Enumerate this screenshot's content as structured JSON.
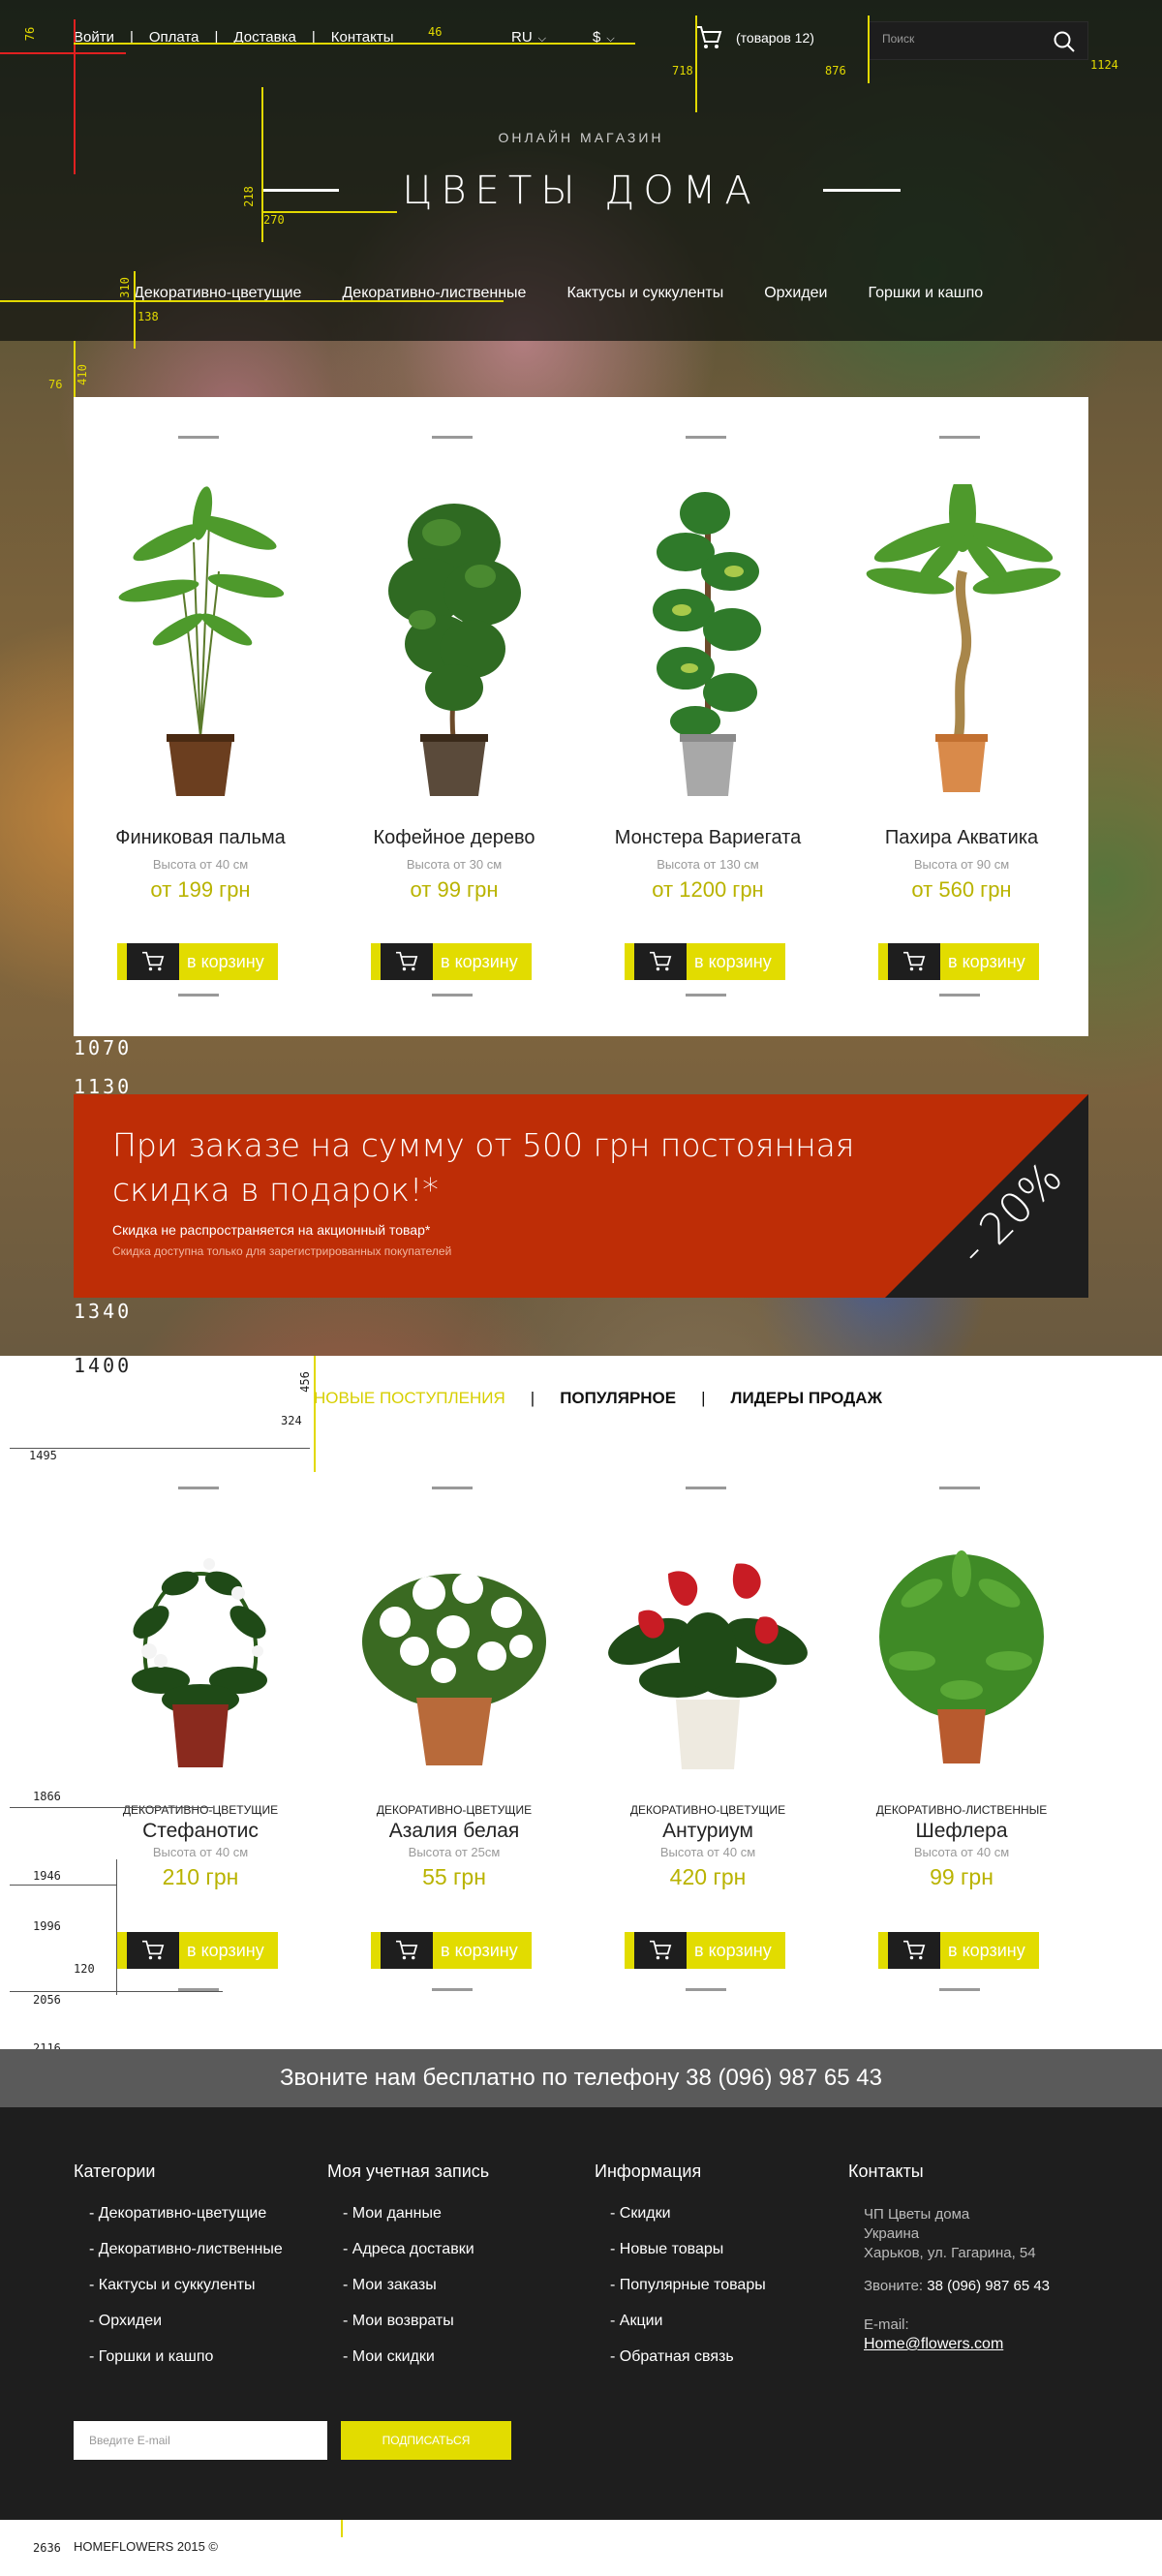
{
  "header": {
    "nav": [
      {
        "label": "Войти"
      },
      {
        "label": "Оплата"
      },
      {
        "label": "Доставка"
      },
      {
        "label": "Контакты"
      }
    ],
    "language": "RU",
    "currency": "$",
    "cart_label": "(товаров 12)",
    "search_placeholder": "Поиск",
    "subtitle": "ОНЛАЙН МАГАЗИН",
    "title": "ЦВЕТЫ ДОМА",
    "categories": [
      {
        "label": "Декоративно-цветущие"
      },
      {
        "label": "Декоративно-лиственные"
      },
      {
        "label": "Кактусы и суккуленты"
      },
      {
        "label": "Орхидеи"
      },
      {
        "label": "Горшки и кашпо"
      }
    ]
  },
  "featured": [
    {
      "name": "Финиковая пальма",
      "height": "Высота от 40 см",
      "price": "от 199 грн",
      "icon": "palm-plant"
    },
    {
      "name": "Кофейное дерево",
      "height": "Высота от 30 см",
      "price": "от 99 грн",
      "icon": "coffee-tree"
    },
    {
      "name": "Монстера Вариегата",
      "height": "Высота от 130 см",
      "price": "от 1200 грн",
      "icon": "monstera"
    },
    {
      "name": "Пахира Акватика",
      "height": "Высота от 90 см",
      "price": "от 560 грн",
      "icon": "pachira"
    }
  ],
  "cart_button_label": "в корзину",
  "promo": {
    "headline": "При заказе на сумму от 500 грн постоянная скидка в подарок!*",
    "note1": "Скидка не распространяется на акционный товар*",
    "note2": "Скидка доступна только для зарегистрированных покупателей",
    "discount": "- 20%"
  },
  "tabs": [
    {
      "label": "НОВЫЕ ПОСТУПЛЕНИЯ",
      "active": true
    },
    {
      "label": "ПОПУЛЯРНОЕ",
      "active": false
    },
    {
      "label": "ЛИДЕРЫ ПРОДАЖ",
      "active": false
    }
  ],
  "new_arrivals": [
    {
      "category": "ДЕКОРАТИВНО-ЦВЕТУЩИЕ",
      "name": "Стефанотис",
      "height": "Высота от 40 см",
      "price": "210 грн",
      "icon": "stephanotis"
    },
    {
      "category": "ДЕКОРАТИВНО-ЦВЕТУЩИЕ",
      "name": "Азалия белая",
      "height": "Высота от 25см",
      "price": "55 грн",
      "icon": "azalea"
    },
    {
      "category": "ДЕКОРАТИВНО-ЦВЕТУЩИЕ",
      "name": "Антуриум",
      "height": "Высота от 40 см",
      "price": "420 грн",
      "icon": "anthurium"
    },
    {
      "category": "ДЕКОРАТИВНО-ЛИСТВЕННЫЕ",
      "name": "Шефлера",
      "height": "Высота от 40 см",
      "price": "99 грн",
      "icon": "schefflera"
    }
  ],
  "call_bar": "Звоните нам бесплатно по телефону 38 (096) 987 65 43",
  "footer": {
    "categories": {
      "title": "Категории",
      "items": [
        "- Декоративно-цветущие",
        "- Декоративно-лиственные",
        "- Кактусы и суккуленты",
        "- Орхидеи",
        "- Горшки и кашпо"
      ]
    },
    "account": {
      "title": "Моя учетная запись",
      "items": [
        "- Мои данные",
        "- Адреса доставки",
        "- Мои заказы",
        "- Мои возвраты",
        "- Мои скидки"
      ]
    },
    "info": {
      "title": "Информация",
      "items": [
        "- Скидки",
        "- Новые товары",
        "- Популярные товары",
        "- Акции",
        "- Обратная связь"
      ]
    },
    "contacts": {
      "title": "Контакты",
      "company": "ЧП Цветы дома",
      "country": "Украина",
      "address": "Харьков, ул. Гагарина, 54",
      "phone_label": "Звоните:",
      "phone": "38 (096) 987 65 43",
      "email_label": "E-mail:",
      "email": "Home@flowers.com"
    },
    "subscribe_placeholder": "Введите E-mail",
    "subscribe_button": "ПОДПИСАТЬСЯ"
  },
  "copyright": "HOMEFLOWERS 2015 ©",
  "guides": [
    "76",
    "46",
    "718",
    "876",
    "1124",
    "218",
    "270",
    "310",
    "138",
    "410",
    "76",
    "1070",
    "1130",
    "1340",
    "1400",
    "456",
    "324",
    "1495",
    "1866",
    "1946",
    "1996",
    "120",
    "2056",
    "2116",
    "2176",
    "286",
    "2234",
    "2542",
    "2352",
    "2636"
  ],
  "colors": {
    "accent": "#e2dc00",
    "price": "#b9b300",
    "promo": "#be2d06",
    "dark": "#1e1e1e",
    "callbar": "#5a5a5a"
  }
}
